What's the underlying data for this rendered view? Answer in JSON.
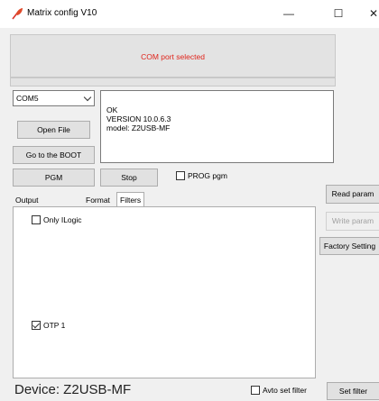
{
  "window": {
    "title": "Matrix config V10",
    "controls": {
      "minimize": "—",
      "maximize": "☐",
      "close": "✕"
    }
  },
  "status": {
    "text": "COM port selected",
    "color": "#e0241b"
  },
  "port": {
    "selected": "COM5"
  },
  "buttons": {
    "open_file": "Open File",
    "go_boot": "Go to the BOOT",
    "pgm": "PGM",
    "stop": "Stop",
    "read_params": "Read param",
    "write_params": "Write param",
    "factory_settings": "Factory Setting",
    "set_filter": "Set filter"
  },
  "log": {
    "lines": [
      "OK",
      "VERSION  10.0.6.3",
      "model: Z2USB-MF"
    ]
  },
  "prog_pgm": {
    "label": "PROG pgm",
    "checked": false
  },
  "tabs": [
    {
      "label": "Output protocol",
      "active": false
    },
    {
      "label": "Format",
      "active": false
    },
    {
      "label": "Filters",
      "active": true
    }
  ],
  "filters": {
    "only_ilogic": {
      "label": "Only ILogic",
      "checked": false
    },
    "otp1": {
      "label": "OTP 1",
      "checked": true
    }
  },
  "footer": {
    "device": "Device: Z2USB-MF",
    "avto_set_filter": {
      "label": "Avto set filter",
      "checked": false
    }
  }
}
